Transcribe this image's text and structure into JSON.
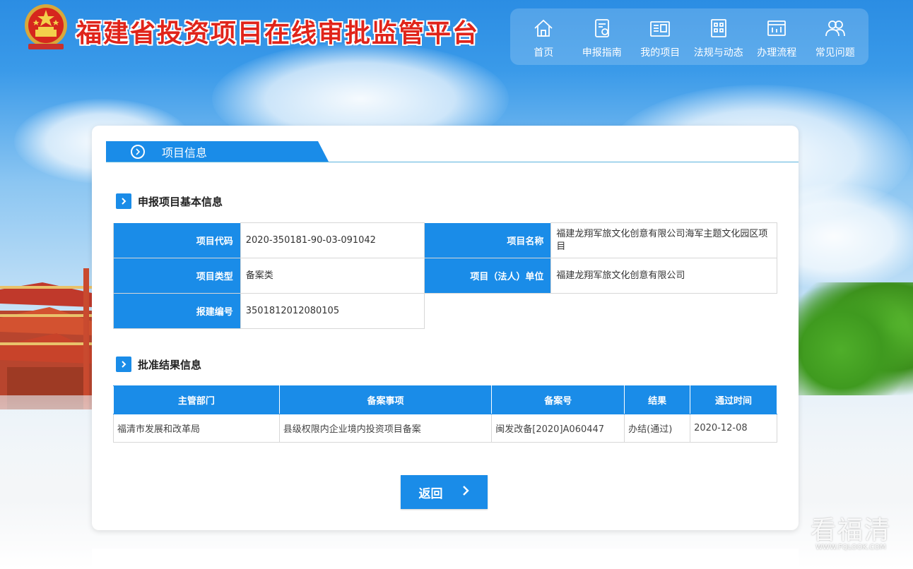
{
  "header": {
    "site_title": "福建省投资项目在线审批监管平台"
  },
  "nav": {
    "items": [
      {
        "label": "首页",
        "icon": "home-icon"
      },
      {
        "label": "申报指南",
        "icon": "guide-icon"
      },
      {
        "label": "我的项目",
        "icon": "project-icon"
      },
      {
        "label": "法规与动态",
        "icon": "regulations-icon"
      },
      {
        "label": "办理流程",
        "icon": "process-icon"
      },
      {
        "label": "常见问题",
        "icon": "faq-icon"
      }
    ]
  },
  "section": {
    "tab_label": "项目信息"
  },
  "basic_info": {
    "title": "申报项目基本信息",
    "code_label": "项目代码",
    "code_value": "2020-350181-90-03-091042",
    "name_label": "项目名称",
    "name_value": "福建龙翔军旅文化创意有限公司海军主题文化园区项目",
    "type_label": "项目类型",
    "type_value": "备案类",
    "unit_label": "项目（法人）单位",
    "unit_value": "福建龙翔军旅文化创意有限公司",
    "build_label": "报建编号",
    "build_value": "3501812012080105"
  },
  "result_info": {
    "title": "批准结果信息",
    "columns": [
      "主管部门",
      "备案事项",
      "备案号",
      "结果",
      "通过时间"
    ],
    "rows": [
      [
        "福清市发展和改革局",
        "县级权限内企业境内投资项目备案",
        "闽发改备[2020]A060447",
        "办结(通过)",
        "2020-12-08"
      ]
    ]
  },
  "actions": {
    "back_label": "返回"
  },
  "watermark": {
    "big": "看福清",
    "small": "WWW.FQLOOK.COM"
  },
  "colors": {
    "primary": "#1a8ce8",
    "title_red": "#e0241a",
    "border": "#d7d7d7"
  }
}
